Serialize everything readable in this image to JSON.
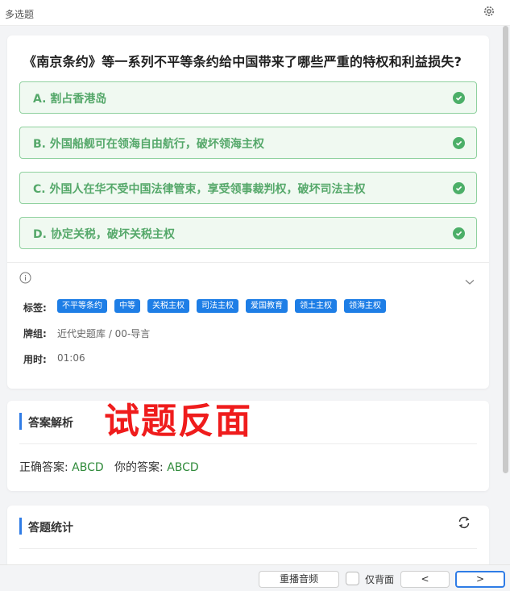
{
  "header": {
    "title": "多选题",
    "settings_icon": "gear-icon"
  },
  "question": {
    "text": "《南京条约》等一系列不平等条约给中国带来了哪些严重的特权和利益损失?",
    "options": [
      {
        "label": "A. 割占香港岛",
        "selected": true
      },
      {
        "label": "B. 外国船舰可在领海自由航行，破坏领海主权",
        "selected": true
      },
      {
        "label": "C. 外国人在华不受中国法律管束，享受领事裁判权，破坏司法主权",
        "selected": true
      },
      {
        "label": "D. 协定关税，破坏关税主权",
        "selected": true
      }
    ],
    "option_color": "#55a86a"
  },
  "meta": {
    "tags_label": "标签:",
    "tags": [
      "不平等条约",
      "中等",
      "关税主权",
      "司法主权",
      "爱国教育",
      "领土主权",
      "领海主权"
    ],
    "deck_label": "牌组:",
    "deck_value": "近代史题库 / 00-导言",
    "time_label": "用时:",
    "time_value": "01:06"
  },
  "watermark_text": "试题反面",
  "analysis": {
    "title": "答案解析",
    "correct_label": "正确答案:",
    "correct_value": "ABCD",
    "yours_label": "你的答案:",
    "yours_value": "ABCD"
  },
  "stats": {
    "title": "答题统计",
    "refresh_icon": "refresh-icon"
  },
  "footer": {
    "replay_label": "重播音频",
    "back_only_label": "仅背面",
    "prev_label": "<",
    "next_label": ">"
  },
  "colors": {
    "accent": "#2f7ce6",
    "success": "#4caf68",
    "tag": "#1e7ee6",
    "watermark": "#ef1c1c"
  }
}
